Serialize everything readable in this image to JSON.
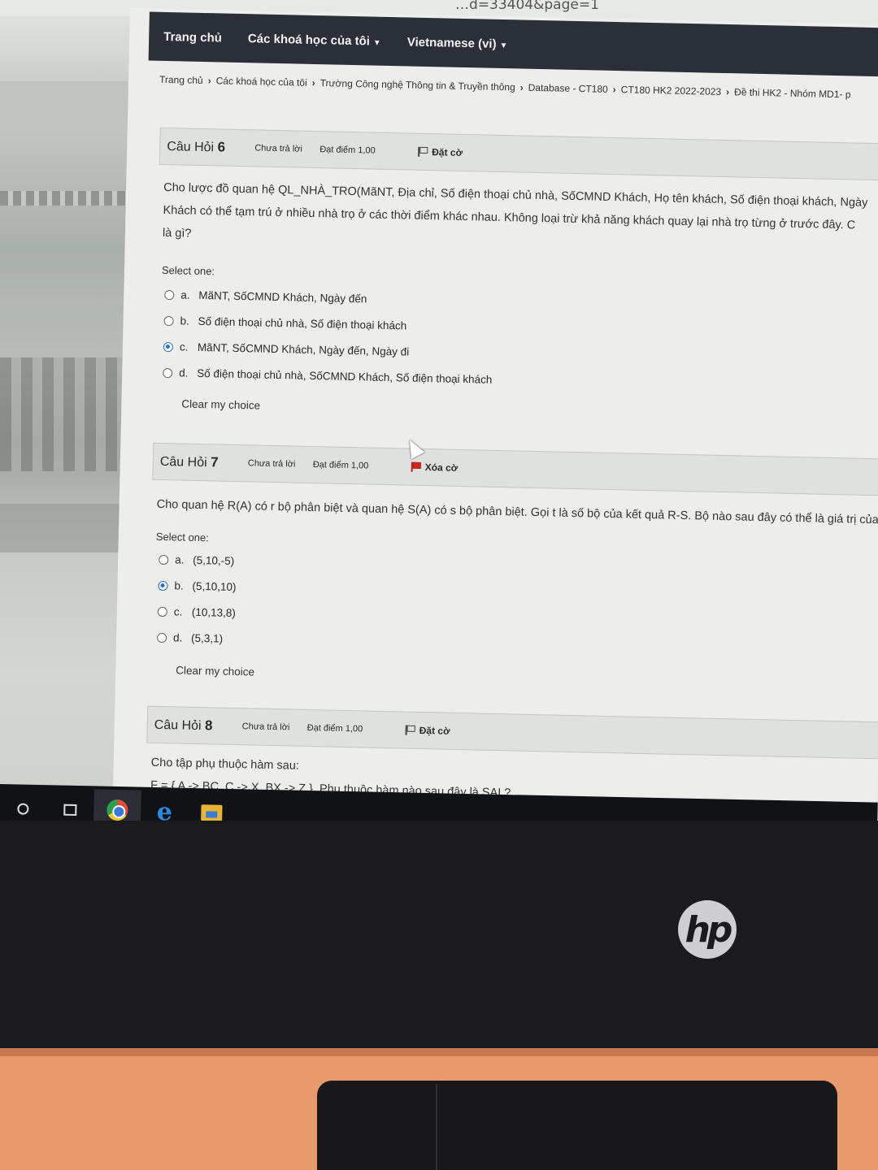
{
  "url_fragment": "…d=33404&page=1",
  "navbar": {
    "home": "Trang chủ",
    "my_courses": "Các khoá học của tôi",
    "language": "Vietnamese (vi)"
  },
  "breadcrumb": [
    "Trang chủ",
    "Các khoá học của tôi",
    "Trường Công nghệ Thông tin & Truyền thông",
    "Database - CT180",
    "CT180 HK2 2022-2023",
    "Đề thi HK2 - Nhóm MD1- p"
  ],
  "questions": [
    {
      "title_prefix": "Câu Hỏi",
      "number": "6",
      "status": "Chưa trả lời",
      "mark": "Đạt điểm 1,00",
      "flag_label": "Đặt cờ",
      "flagged": false,
      "text_lines": [
        "Cho lược đồ quan hệ QL_NHÀ_TRO(MãNT, Địa chỉ, Số điện thoại chủ nhà, SốCMND Khách, Họ tên khách, Số điện thoại khách, Ngày",
        "Khách có thể tạm trú ở nhiều nhà trọ ở các thời điểm khác nhau. Không loại trừ khả năng khách quay lại nhà trọ từng ở trước đây. C",
        "là gì?"
      ],
      "select_label": "Select one:",
      "options": [
        {
          "letter": "a.",
          "text": "MãNT, SốCMND Khách, Ngày đến",
          "checked": false
        },
        {
          "letter": "b.",
          "text": "Số điện thoại chủ nhà, Số điện thoại khách",
          "checked": false
        },
        {
          "letter": "c.",
          "text": "MãNT, SốCMND Khách, Ngày đến, Ngày đi",
          "checked": true
        },
        {
          "letter": "d.",
          "text": "Số điện thoại chủ nhà, SốCMND Khách, Số điện thoại khách",
          "checked": false
        }
      ],
      "clear_label": "Clear my choice"
    },
    {
      "title_prefix": "Câu Hỏi",
      "number": "7",
      "status": "Chưa trả lời",
      "mark": "Đạt điểm 1,00",
      "flag_label": "Xóa cờ",
      "flagged": true,
      "text_lines": [
        "Cho quan hệ R(A) có r bộ phân biệt và quan hệ S(A) có s bộ phân biệt. Gọi t là số bộ của kết quả R-S. Bộ nào sau đây có thể là giá trị của"
      ],
      "select_label": "Select one:",
      "options": [
        {
          "letter": "a.",
          "text": "(5,10,-5)",
          "checked": false
        },
        {
          "letter": "b.",
          "text": "(5,10,10)",
          "checked": true
        },
        {
          "letter": "c.",
          "text": "(10,13,8)",
          "checked": false
        },
        {
          "letter": "d.",
          "text": "(5,3,1)",
          "checked": false
        }
      ],
      "clear_label": "Clear my choice"
    },
    {
      "title_prefix": "Câu Hỏi",
      "number": "8",
      "status": "Chưa trả lời",
      "mark": "Đạt điểm 1,00",
      "flag_label": "Đặt cờ",
      "flagged": false,
      "text_lines": [
        "Cho tập phụ thuộc hàm sau:",
        "F = { A -> BC, C -> X, BX -> Z }. Phụ thuộc hàm nào sau đây là SAI ?"
      ]
    }
  ],
  "taskbar": {
    "items": [
      "cortana-icon",
      "task-view-icon",
      "chrome-icon",
      "edge-icon",
      "file-explorer-icon"
    ],
    "active": "chrome-icon"
  },
  "monitor_brand": "hp"
}
